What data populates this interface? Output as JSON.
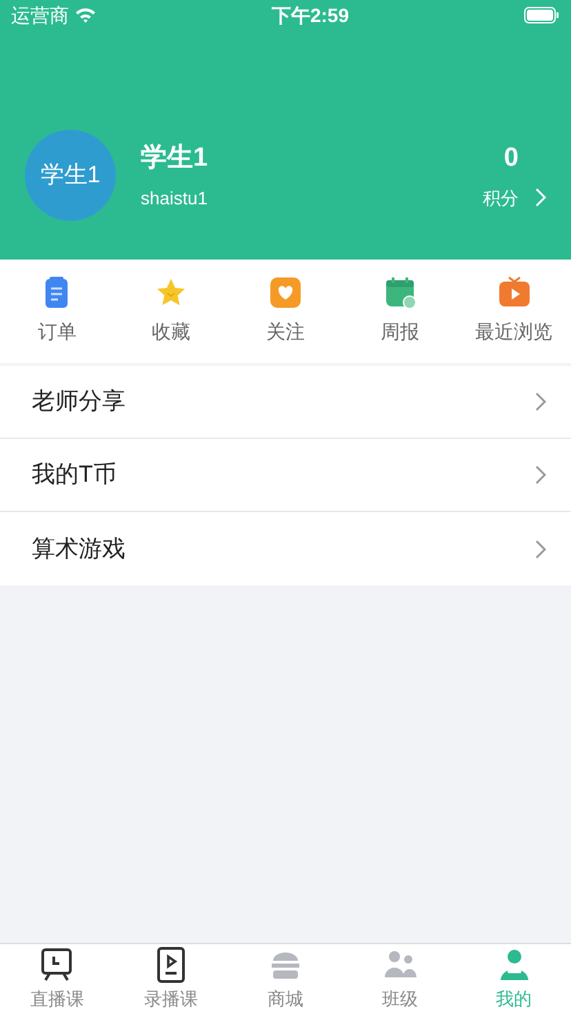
{
  "status_bar": {
    "carrier": "运营商",
    "time": "下午2:59"
  },
  "profile": {
    "avatar_text": "学生1",
    "name": "学生1",
    "username": "shaistu1",
    "points_value": "0",
    "points_label": "积分"
  },
  "shortcuts": [
    {
      "kind": "order",
      "label": "订单"
    },
    {
      "kind": "star",
      "label": "收藏"
    },
    {
      "kind": "heart",
      "label": "关注"
    },
    {
      "kind": "calendar",
      "label": "周报"
    },
    {
      "kind": "tv",
      "label": "最近浏览"
    }
  ],
  "menu": [
    {
      "label": "老师分享"
    },
    {
      "label": "我的T币"
    },
    {
      "label": "算术游戏"
    }
  ],
  "tab_bar": [
    {
      "kind": "live",
      "label": "直播课",
      "selected": false
    },
    {
      "kind": "video",
      "label": "录播课",
      "selected": false
    },
    {
      "kind": "shop",
      "label": "商城",
      "selected": false
    },
    {
      "kind": "class",
      "label": "班级",
      "selected": false
    },
    {
      "kind": "me",
      "label": "我的",
      "selected": true
    }
  ]
}
